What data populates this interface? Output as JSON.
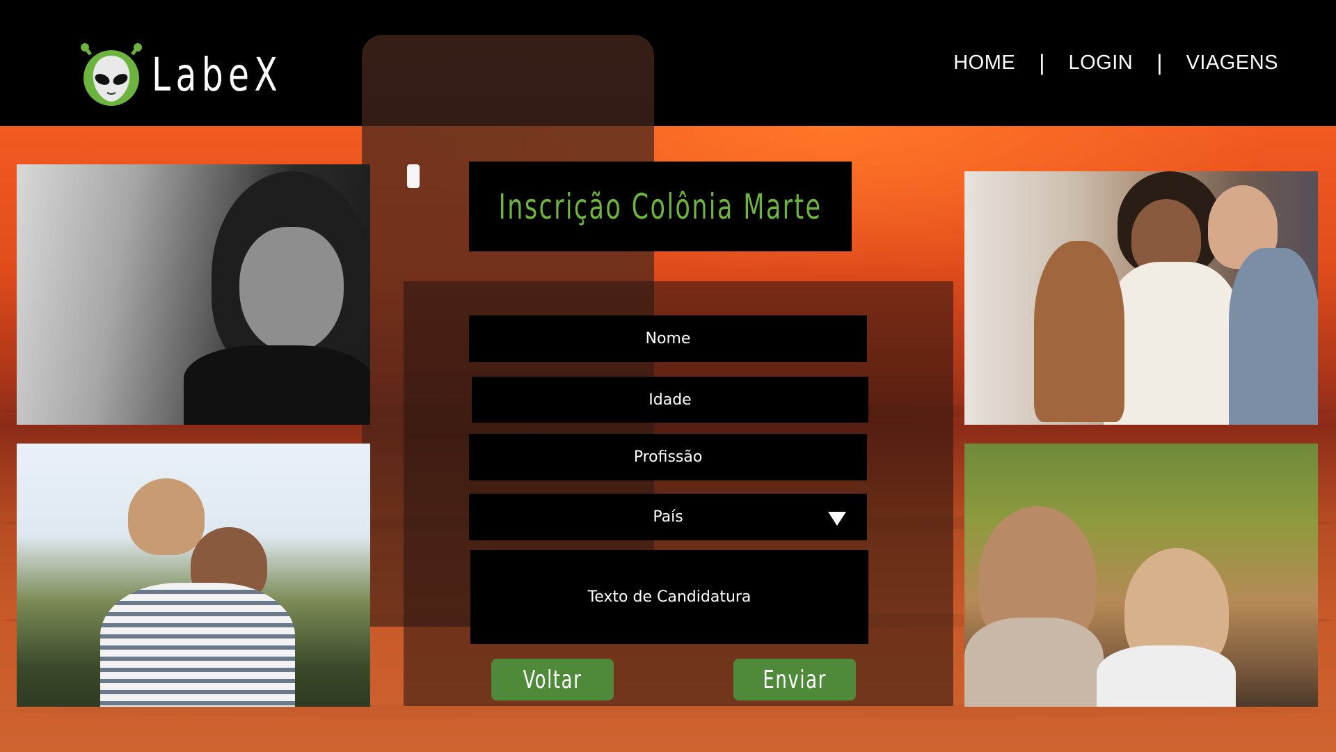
{
  "header": {
    "logo_text": "LabeX",
    "nav": [
      {
        "label": "HOME"
      },
      {
        "label": "LOGIN"
      },
      {
        "label": "VIAGENS"
      }
    ],
    "separator": "|"
  },
  "form": {
    "title": "Inscrição Colônia Marte",
    "fields": {
      "nome": "Nome",
      "idade": "Idade",
      "profissao": "Profissão",
      "pais": "País",
      "texto": "Texto de Candidatura"
    },
    "buttons": {
      "voltar": "Voltar",
      "enviar": "Enviar"
    }
  },
  "colors": {
    "accent_green": "#6cb33f",
    "button_green": "#4e8a3a",
    "background_orange": "#e24d1c"
  },
  "icons": {
    "logo": "alien-icon",
    "select": "caret-down-icon"
  }
}
